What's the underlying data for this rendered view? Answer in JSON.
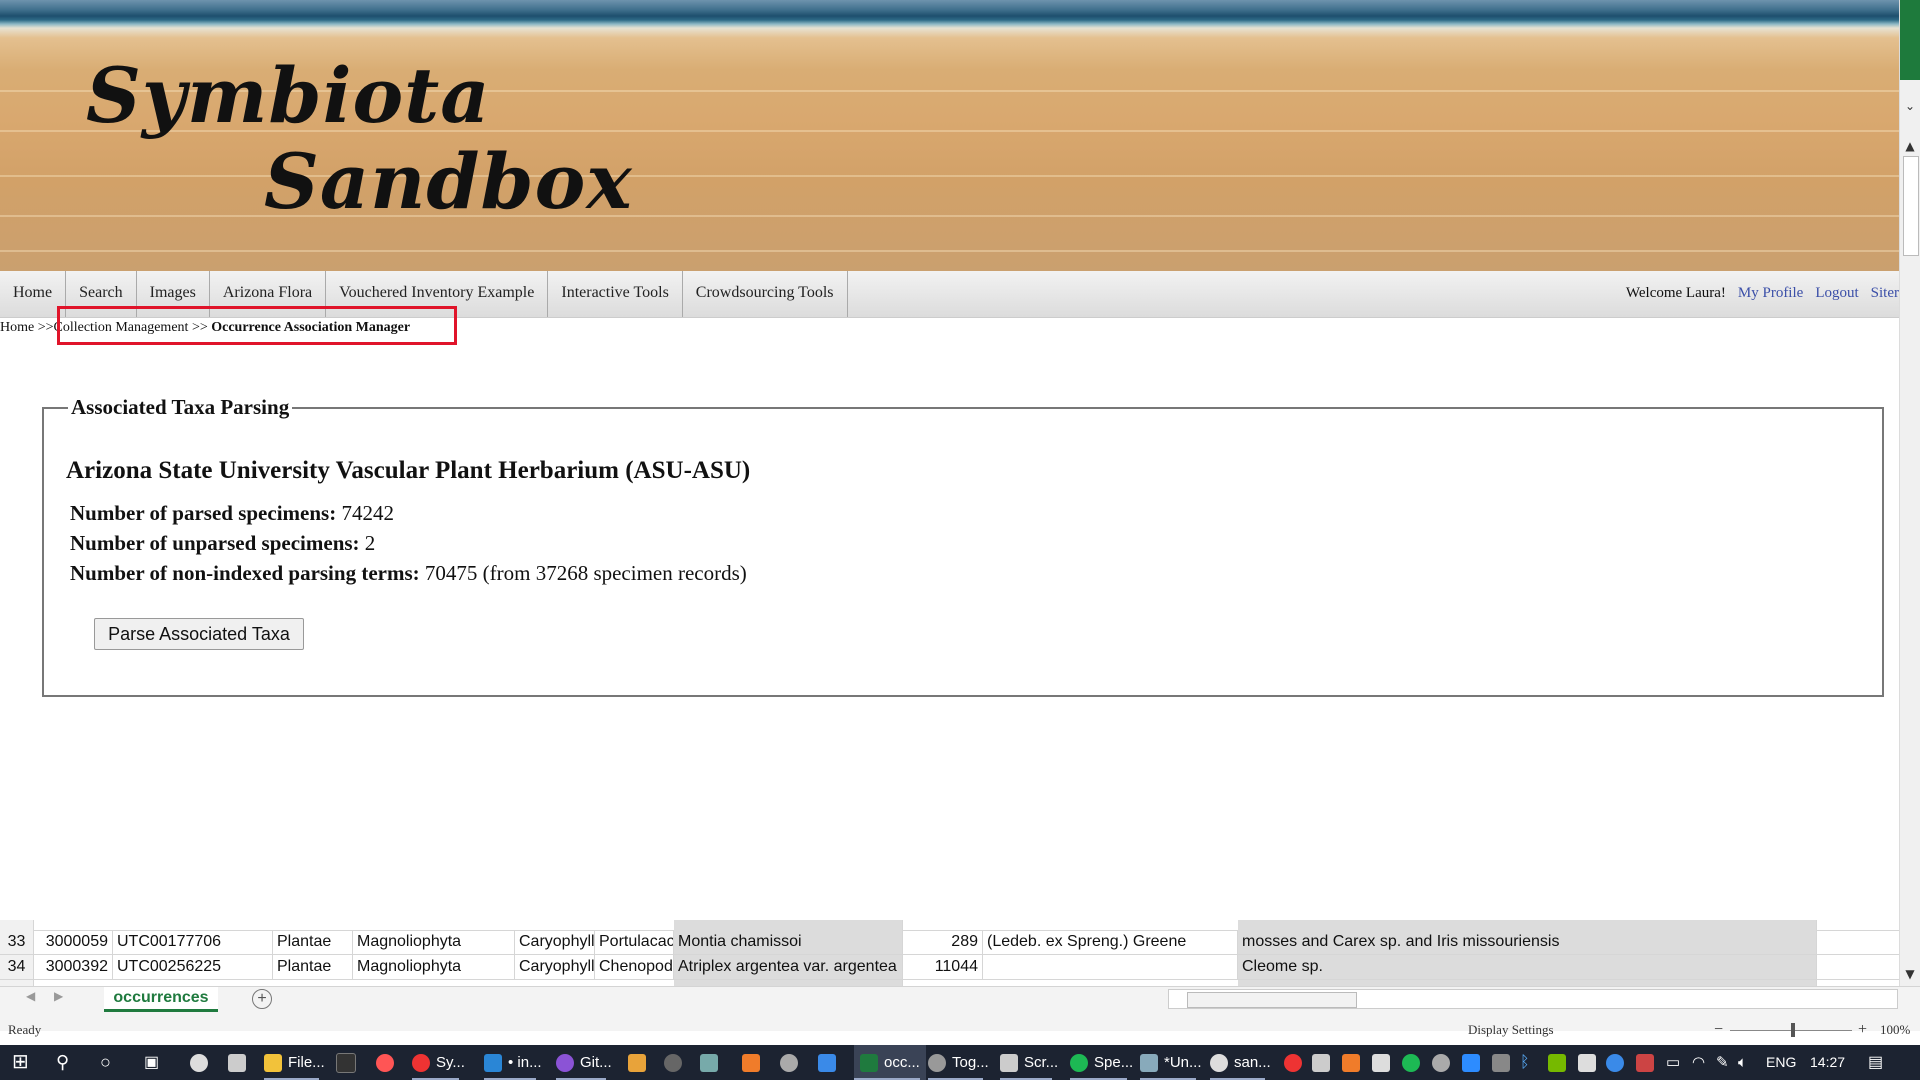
{
  "site": {
    "title_line1": "Symbiota",
    "title_line2": "Sandbox"
  },
  "nav": {
    "items": [
      "Home",
      "Search",
      "Images",
      "Arizona Flora",
      "Vouchered Inventory Example",
      "Interactive Tools",
      "Crowdsourcing Tools"
    ],
    "welcome": "Welcome Laura!",
    "my_profile": "My Profile",
    "logout": "Logout",
    "sitemap": "Siter"
  },
  "breadcrumb": {
    "home": "Home",
    "sep": ">>",
    "collection_management": "Collection Management",
    "current": "Occurrence Association Manager"
  },
  "panel": {
    "legend": "Associated Taxa Parsing",
    "collection": "Arizona State University Vascular Plant Herbarium (ASU-ASU)",
    "parsed_label": "Number of parsed specimens:",
    "parsed_value": "74242",
    "unparsed_label": "Number of unparsed specimens:",
    "unparsed_value": "2",
    "nonindexed_label": "Number of non-indexed parsing terms:",
    "nonindexed_value": "70475 (from 37268 specimen records)",
    "button": "Parse Associated Taxa"
  },
  "spreadsheet": {
    "rows": [
      {
        "rn": "33",
        "id": "3000059",
        "catalog": "UTC00177706",
        "kingdom": "Plantae",
        "phylum": "Magnoliophyta",
        "order": "Caryophyll",
        "family": "Portulacac",
        "sciname": "Montia chamissoi",
        "num": "289",
        "author": "(Ledeb. ex Spreng.) Greene",
        "assoc": "mosses and Carex sp. and Iris missouriensis"
      },
      {
        "rn": "34",
        "id": "3000392",
        "catalog": "UTC00256225",
        "kingdom": "Plantae",
        "phylum": "Magnoliophyta",
        "order": "Caryophyll",
        "family": "Chenopod",
        "sciname": "Atriplex argentea var. argentea",
        "num": "11044",
        "author": "",
        "assoc": "Cleome sp."
      }
    ],
    "sheet_tab": "occurrences",
    "status": "Ready",
    "display_settings": "Display Settings",
    "zoom": "100%"
  },
  "taskbar": {
    "apps": [
      "File...",
      "Sy...",
      "• in...",
      "Git...",
      "occ...",
      "Tog...",
      "Scr...",
      "Spe...",
      "*Un...",
      "san..."
    ],
    "lang": "ENG",
    "time": "14:27"
  }
}
